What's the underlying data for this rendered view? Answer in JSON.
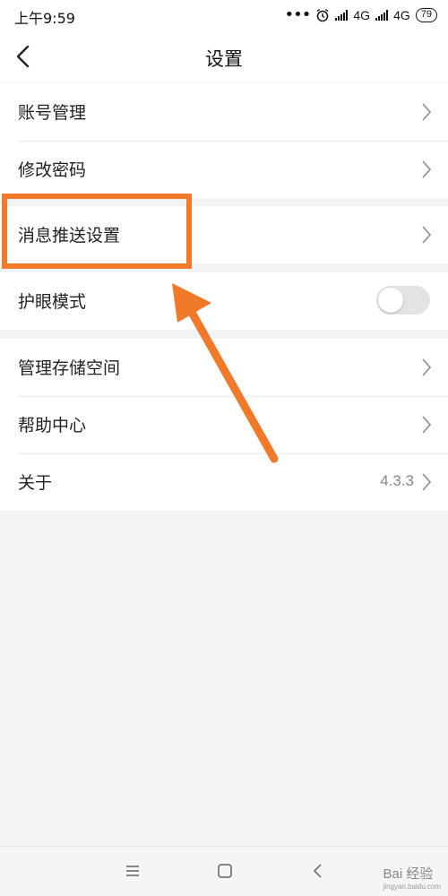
{
  "status_bar": {
    "time": "上午9:59",
    "dots": "•••",
    "network1": "4G",
    "network2": "4G",
    "battery": "79"
  },
  "header": {
    "title": "设置"
  },
  "settings": {
    "account": "账号管理",
    "password": "修改密码",
    "push": "消息推送设置",
    "eye_mode": "护眼模式",
    "eye_mode_on": false,
    "storage": "管理存储空间",
    "help": "帮助中心",
    "about": "关于",
    "version": "4.3.3"
  },
  "watermark": {
    "brand": "Bai 经验",
    "url": "jingyan.baidu.com"
  },
  "colors": {
    "accent": "#f07a2a"
  }
}
